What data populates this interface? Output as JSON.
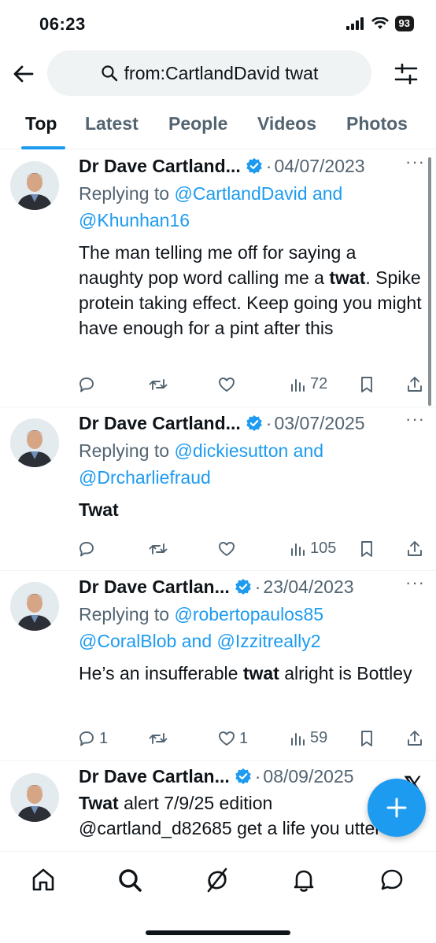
{
  "status_bar": {
    "time": "06:23",
    "battery": "93"
  },
  "search": {
    "query": "from:CartlandDavid twat"
  },
  "tabs": [
    {
      "label": "Top",
      "active": true
    },
    {
      "label": "Latest",
      "active": false
    },
    {
      "label": "People",
      "active": false
    },
    {
      "label": "Videos",
      "active": false
    },
    {
      "label": "Photos",
      "active": false
    }
  ],
  "tweets": [
    {
      "name": "Dr Dave Cartland...",
      "dot": "·",
      "date": "04/07/2023",
      "replying_prefix": "Replying to ",
      "replying_line1": "@CartlandDavid and",
      "replying_line2": "@Khunhan16",
      "text_before": "The man telling me off for saying a naughty pop word calling me a ",
      "text_bold": "twat",
      "text_after": ". Spike protein taking effect.  Keep going you might have enough for a pint after this",
      "replies": "",
      "likes": "",
      "views": "72"
    },
    {
      "name": "Dr Dave Cartland...",
      "dot": "·",
      "date": "03/07/2025",
      "replying_prefix": "Replying to ",
      "replying_line1": "@dickiesutton and",
      "replying_line2": "@Drcharliefraud",
      "text_bold": "Twat",
      "replies": "",
      "likes": "",
      "views": "105"
    },
    {
      "name": "Dr Dave Cartlan...",
      "dot": "·",
      "date": "23/04/2023",
      "replying_prefix": "Replying to ",
      "replying_line1": "@robertopaulos85",
      "replying_line2": "@CoralBlob and @Izzitreally2",
      "text_before": "He’s an insufferable ",
      "text_bold": "twat",
      "text_after": " alright is Bottley",
      "replies": "1",
      "likes": "1",
      "views": "59"
    },
    {
      "name": "Dr Dave Cartlan...",
      "dot": "·",
      "date": "08/09/2025",
      "text_bold": "Twat",
      "text_after": " alert 7/9/25 edition",
      "text_line2": "@cartland_d82685 get a life you utter"
    }
  ],
  "more_label": "···",
  "x_mark": "𝕏",
  "colors": {
    "accent": "#1d9bf0",
    "secondary_text": "#536471",
    "primary_text": "#0f1419"
  },
  "icons": [
    "back-arrow-icon",
    "search-icon",
    "filter-icon",
    "verified-icon",
    "reply-icon",
    "retweet-icon",
    "like-icon",
    "views-icon",
    "bookmark-icon",
    "share-icon",
    "compose-icon",
    "home-icon",
    "explore-icon",
    "grok-icon",
    "notifications-icon",
    "messages-icon"
  ]
}
